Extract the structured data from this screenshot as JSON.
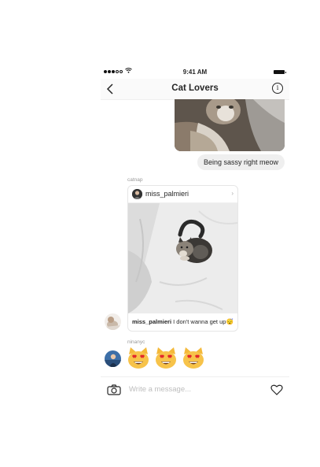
{
  "status_bar": {
    "time": "9:41 AM"
  },
  "header": {
    "title": "Cat Lovers"
  },
  "messages": {
    "outgoing_text": "Being sassy right meow",
    "shared_post": {
      "sender": "catnap",
      "post_user": "miss_palmieri",
      "caption_user": "miss_palmieri",
      "caption_text": "I don't wanna get up😴"
    },
    "emoji_message": {
      "sender": "ninanyc",
      "emojis": [
        "😻",
        "😻",
        "😻"
      ]
    }
  },
  "composer": {
    "placeholder": "Write a message..."
  }
}
